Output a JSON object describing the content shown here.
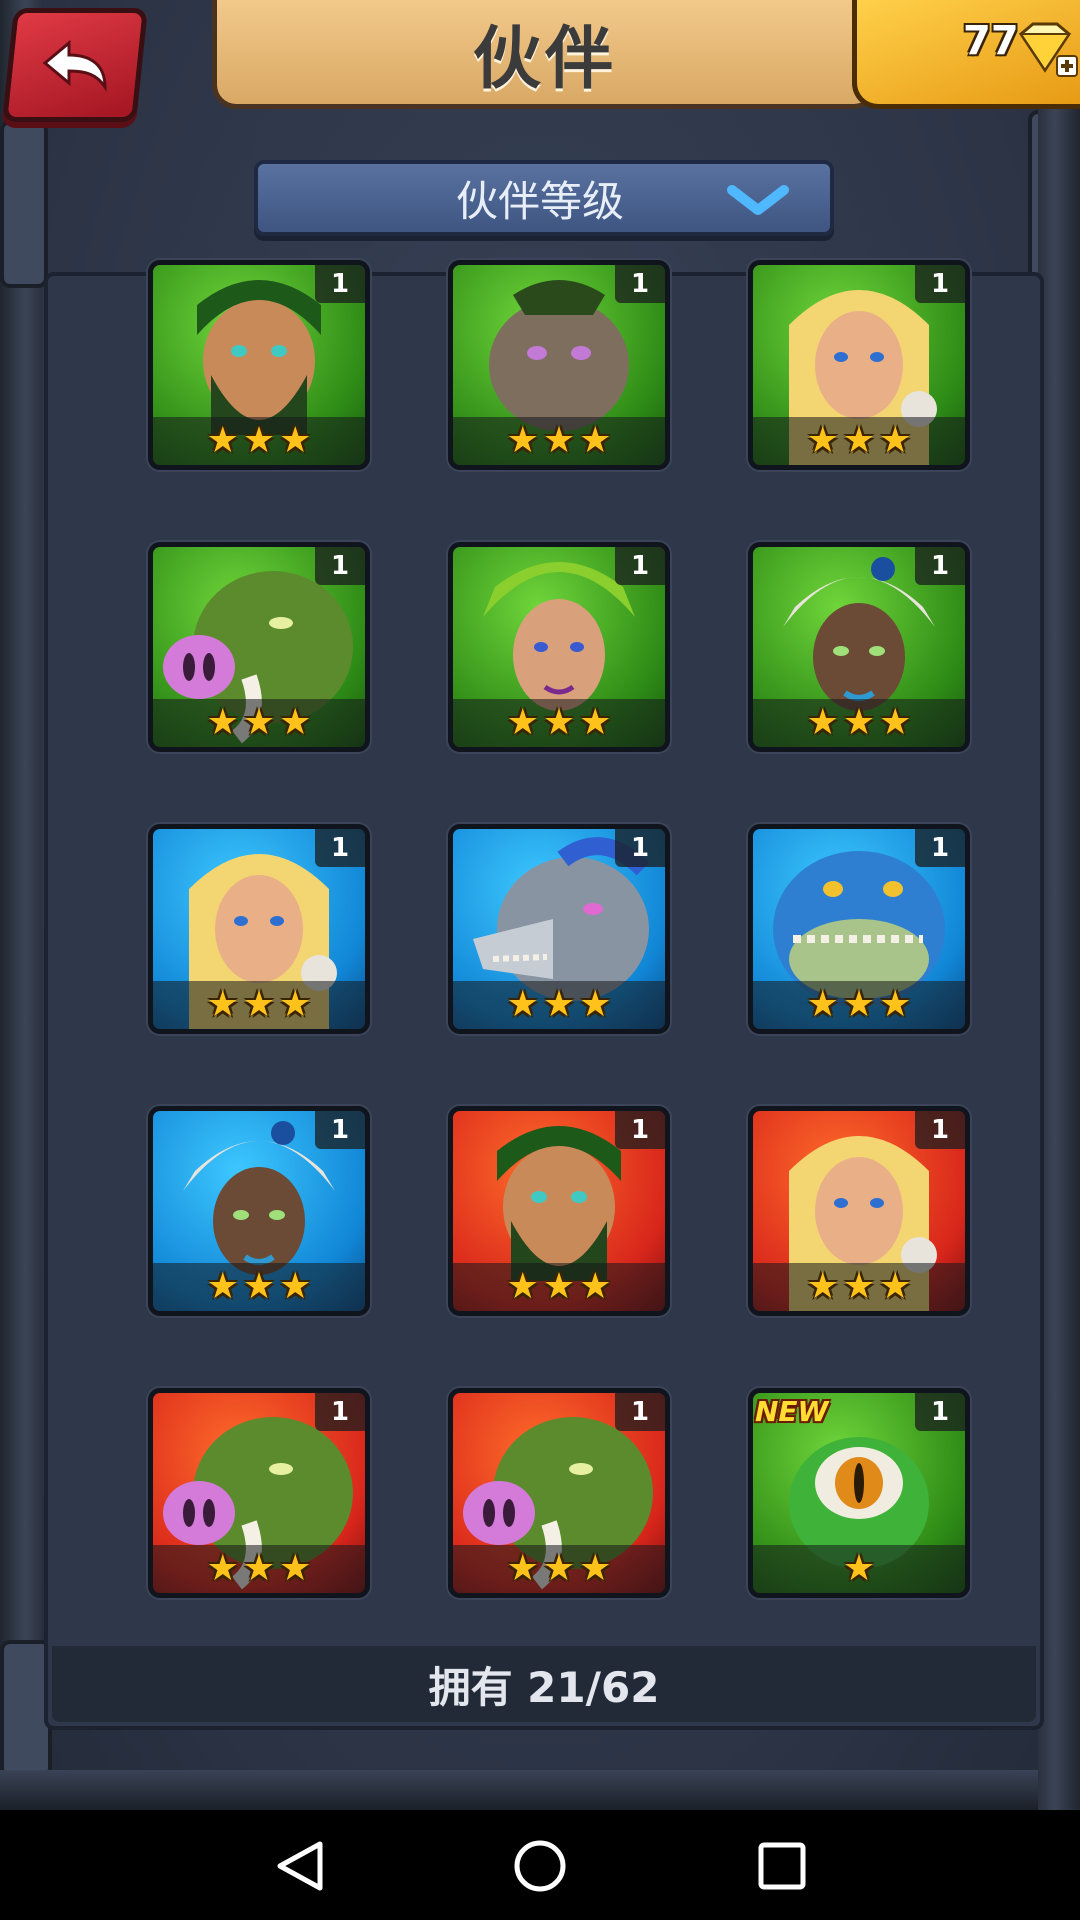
{
  "header": {
    "title": "伙伴",
    "gem_count": "77",
    "back_icon": "back-arrow-icon",
    "gem_icon": "diamond-plus-icon"
  },
  "sort": {
    "label": "伙伴等级",
    "icon": "chevron-down-icon"
  },
  "companions": [
    {
      "level": "1",
      "stars": 3,
      "theme": "green",
      "icon": "bearded-warrior-portrait"
    },
    {
      "level": "1",
      "stars": 3,
      "theme": "green",
      "icon": "ogre-brute-portrait"
    },
    {
      "level": "1",
      "stars": 3,
      "theme": "green",
      "icon": "blonde-huntress-portrait"
    },
    {
      "level": "1",
      "stars": 3,
      "theme": "green",
      "icon": "boar-beast-portrait"
    },
    {
      "level": "1",
      "stars": 3,
      "theme": "green",
      "icon": "leaf-druid-girl-portrait"
    },
    {
      "level": "1",
      "stars": 3,
      "theme": "green",
      "icon": "skull-hood-shaman-portrait"
    },
    {
      "level": "1",
      "stars": 3,
      "theme": "blue",
      "icon": "blonde-huntress-portrait"
    },
    {
      "level": "1",
      "stars": 3,
      "theme": "blue",
      "icon": "werewolf-portrait"
    },
    {
      "level": "1",
      "stars": 3,
      "theme": "blue",
      "icon": "lizard-dragon-portrait"
    },
    {
      "level": "1",
      "stars": 3,
      "theme": "blue",
      "icon": "skull-hood-shaman-portrait"
    },
    {
      "level": "1",
      "stars": 3,
      "theme": "red",
      "icon": "bearded-warrior-portrait"
    },
    {
      "level": "1",
      "stars": 3,
      "theme": "red",
      "icon": "blonde-huntress-portrait"
    },
    {
      "level": "1",
      "stars": 3,
      "theme": "red",
      "icon": "boar-beast-portrait"
    },
    {
      "level": "1",
      "stars": 3,
      "theme": "red",
      "icon": "boar-beast-portrait"
    },
    {
      "level": "1",
      "stars": 1,
      "theme": "green",
      "icon": "one-eyed-slime-portrait",
      "badge": "NEW"
    }
  ],
  "footer": {
    "owned_text": "拥有 21/62"
  },
  "navbar": {
    "back_icon": "nav-back-icon",
    "home_icon": "nav-home-icon",
    "recents_icon": "nav-recents-icon"
  },
  "colors": {
    "green_card": "#2d8a16",
    "blue_card": "#1186d6",
    "red_card": "#d8261b",
    "star": "#ffc21a",
    "title_banner": "#e6b774",
    "gem_box": "#f0b02a",
    "back_button": "#c8232f"
  }
}
